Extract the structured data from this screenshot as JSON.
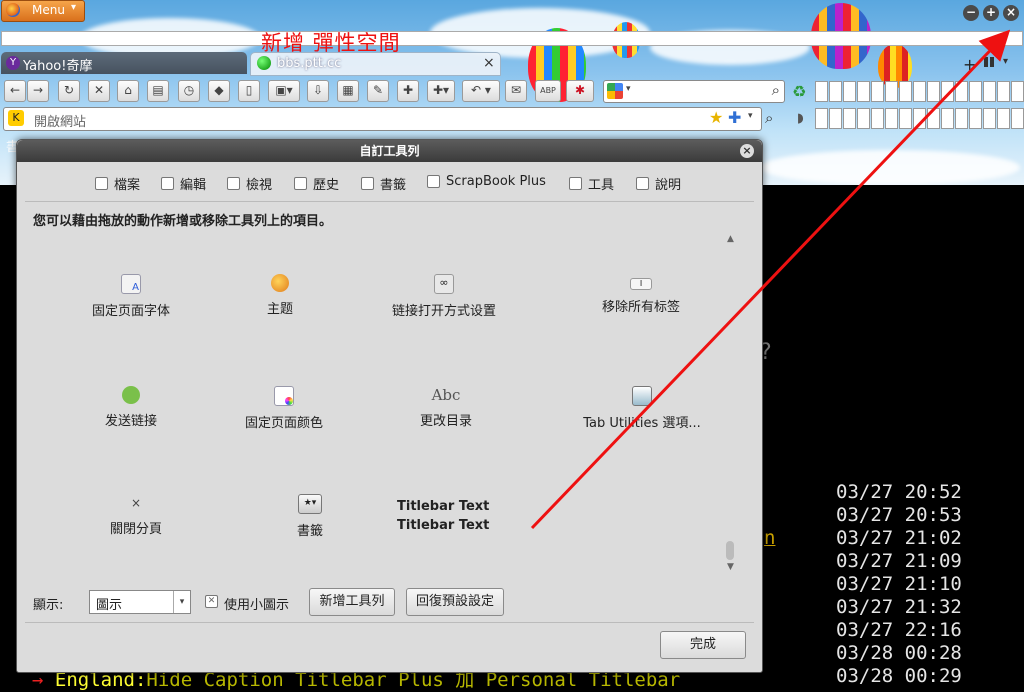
{
  "window": {
    "menu_label": "Menu",
    "annotation_text": "新增 彈性空間"
  },
  "tabs": [
    {
      "label": "Yahoo!奇摩"
    },
    {
      "label": "bbs.ptt.cc"
    }
  ],
  "address_bar": {
    "placeholder": "開啟網站"
  },
  "bookmarks_partial": "書",
  "background_terminal": {
    "timestamps": [
      "03/27  20:52",
      "03/27  20:53",
      "03/27  21:02",
      "03/27  21:09",
      "03/27  21:10",
      "03/27  21:32",
      "03/27  22:16",
      "03/28  00:28",
      "03/28  00:29"
    ],
    "bottom_arrow": "→",
    "bottom_author": "England:",
    "bottom_title": "Hide Caption Titlebar Plus 加 Personal Titlebar",
    "stray_char_q": "?",
    "stray_char_n": "n"
  },
  "dialog": {
    "title": "自訂工具列",
    "toolbar_checkboxes": [
      {
        "label": "檔案"
      },
      {
        "label": "編輯"
      },
      {
        "label": "檢視"
      },
      {
        "label": "歷史"
      },
      {
        "label": "書籤"
      },
      {
        "label": "ScrapBook Plus"
      },
      {
        "label": "工具"
      },
      {
        "label": "說明"
      }
    ],
    "instructions": "您可以藉由拖放的動作新增或移除工具列上的項目。",
    "palette_items": [
      {
        "label": "固定页面字体",
        "icon": "font-doc-icon"
      },
      {
        "label": "主题",
        "icon": "theme-palette-icon"
      },
      {
        "label": "链接打开方式设置",
        "icon": "link-chain-icon"
      },
      {
        "label": "移除所有标签",
        "icon": "remove-tabs-icon"
      },
      {
        "label": "发送链接",
        "icon": "send-link-icon"
      },
      {
        "label": "固定页面颜色",
        "icon": "page-color-icon"
      },
      {
        "label": "更改目录",
        "icon": "change-dir-icon"
      },
      {
        "label": "Tab Utilities 選項...",
        "icon": "tab-utilities-icon"
      },
      {
        "label": "關閉分頁",
        "icon": "close-tab-icon"
      },
      {
        "label": "書籤",
        "icon": "bookmark-star-icon"
      },
      {
        "label": "Titlebar Text",
        "icon": "titlebar-text-icon"
      }
    ],
    "titlebar_text_top": "Titlebar Text",
    "abc_glyph": "Abc",
    "close_tab_glyph": "×",
    "show_label": "顯示:",
    "show_value": "圖示",
    "small_icons_label": "使用小圖示",
    "new_toolbar_button": "新增工具列",
    "restore_default_button": "回復預設設定",
    "done_button": "完成"
  },
  "colors": {
    "annotation": "#e11111",
    "timestamp_text": "#e5e5e5",
    "bottom_author": "#ffff33",
    "bottom_title": "#b8b800",
    "arrow": "#ee1111"
  }
}
